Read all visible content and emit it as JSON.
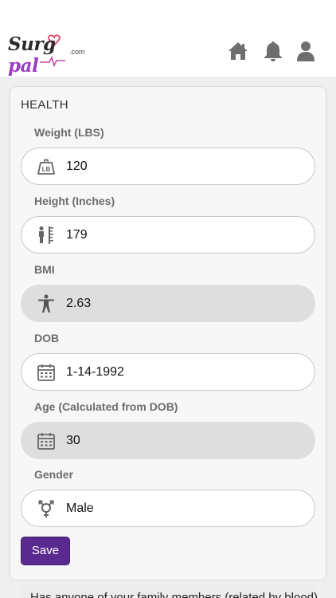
{
  "header": {
    "logo_main": "Surg",
    "logo_accent": "pal",
    "logo_suffix": ".com",
    "icons": [
      "home-icon",
      "bell-icon",
      "user-icon"
    ]
  },
  "health": {
    "title": "HEALTH",
    "fields": [
      {
        "label": "Weight (LBS)",
        "value": "120",
        "icon": "weight-icon",
        "readonly": false
      },
      {
        "label": "Height (Inches)",
        "value": "179",
        "icon": "height-ruler-icon",
        "readonly": false
      },
      {
        "label": "BMI",
        "value": "2.63",
        "icon": "person-icon",
        "readonly": true
      },
      {
        "label": "DOB",
        "value": "1-14-1992",
        "icon": "calendar-icon",
        "readonly": false
      },
      {
        "label": "Age (Calculated from DOB)",
        "value": "30",
        "icon": "calendar-icon",
        "readonly": true
      },
      {
        "label": "Gender",
        "value": "Male",
        "icon": "gender-icon",
        "readonly": false
      }
    ],
    "save_label": "Save"
  },
  "next_section": {
    "text": "Has anyone of your family members (related by blood)"
  },
  "colors": {
    "accent": "#5a2a91",
    "readonly_bg": "#dedede",
    "icon_gray": "#666666"
  }
}
